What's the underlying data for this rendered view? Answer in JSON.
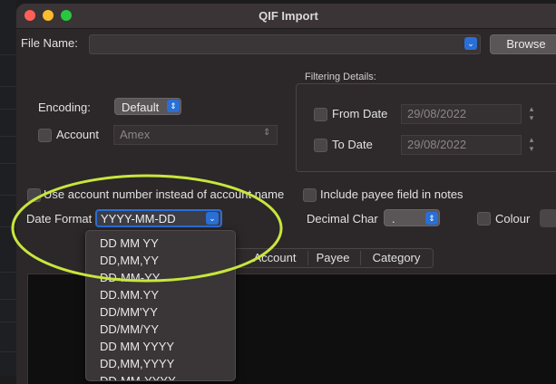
{
  "window": {
    "title": "QIF Import"
  },
  "file": {
    "label": "File Name:",
    "value": "",
    "browse_label": "Browse"
  },
  "encoding": {
    "label": "Encoding:",
    "value": "Default"
  },
  "account": {
    "label": "Account",
    "value": "Amex",
    "checked": false
  },
  "filtering": {
    "title": "Filtering Details:",
    "from_label": "From Date",
    "from_value": "29/08/2022",
    "to_label": "To Date",
    "to_value": "29/08/2022"
  },
  "options": {
    "use_account_number": "Use account number instead of account name",
    "include_payee": "Include payee field in notes"
  },
  "date_format": {
    "label": "Date Format",
    "value": "YYYY-MM-DD"
  },
  "decimal_char": {
    "label": "Decimal Char",
    "value": "."
  },
  "colour": {
    "label": "Colour"
  },
  "tabs": [
    "Account",
    "Payee",
    "Category"
  ],
  "date_format_options": [
    "DD MM YY",
    "DD,MM,YY",
    "DD-MM-YY",
    "DD.MM.YY",
    "DD/MM'YY",
    "DD/MM/YY",
    "DD MM YYYY",
    "DD,MM,YYYY",
    "DD-MM-YYYY"
  ],
  "colors": {
    "accent": "#2a6fd6",
    "annotation": "#c8e63c"
  }
}
